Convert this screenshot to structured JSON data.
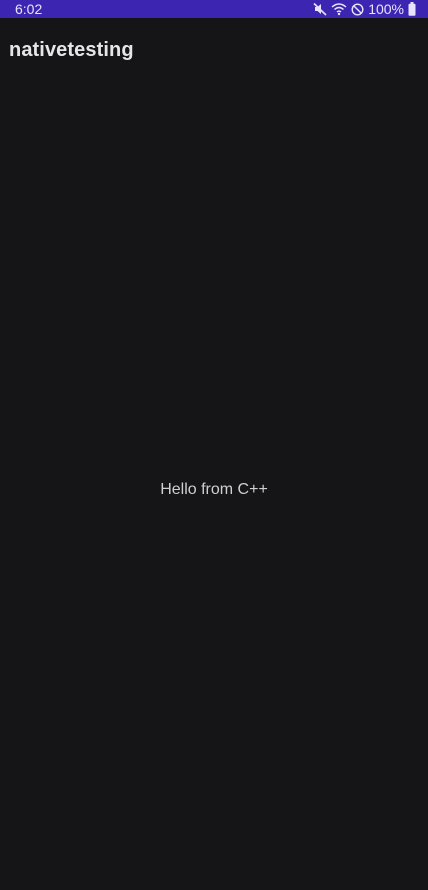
{
  "status_bar": {
    "time": "6:02",
    "battery": "100%",
    "icons": [
      "mute-icon",
      "wifi-icon",
      "no-disturb-icon",
      "battery-icon"
    ],
    "background": "#3c25b0"
  },
  "app_bar": {
    "title": "nativetesting"
  },
  "main": {
    "message": "Hello from C++"
  },
  "colors": {
    "background": "#151517",
    "text": "#cfcfcf"
  }
}
